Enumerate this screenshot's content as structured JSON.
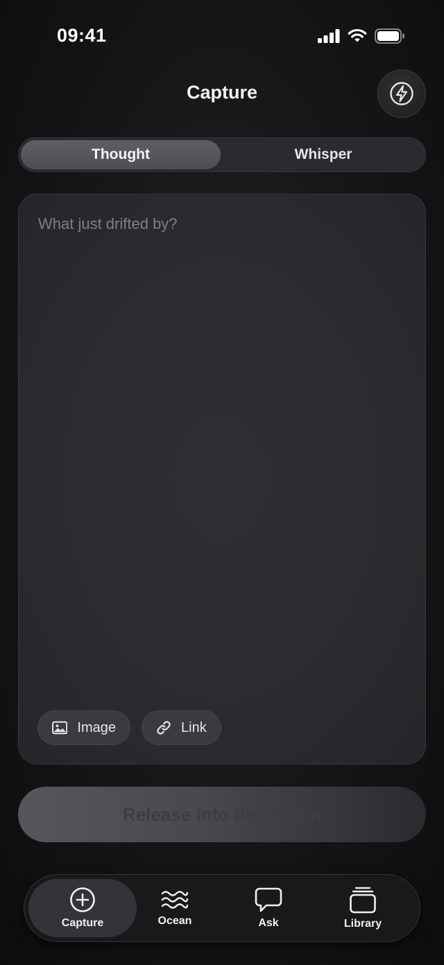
{
  "status_bar": {
    "time": "09:41"
  },
  "header": {
    "title": "Capture"
  },
  "mode_toggle": {
    "options": [
      "Thought",
      "Whisper"
    ],
    "selected": "Thought"
  },
  "composer": {
    "placeholder": "What just drifted by?",
    "attachments": [
      {
        "label": "Image",
        "icon": "image-icon"
      },
      {
        "label": "Link",
        "icon": "link-icon"
      }
    ]
  },
  "release_button": {
    "label": "Release into the Ocean"
  },
  "tab_bar": {
    "items": [
      {
        "label": "Capture",
        "icon": "plus-circle-icon",
        "active": true
      },
      {
        "label": "Ocean",
        "icon": "waves-icon",
        "active": false
      },
      {
        "label": "Ask",
        "icon": "chat-bubble-icon",
        "active": false
      },
      {
        "label": "Library",
        "icon": "stack-icon",
        "active": false
      }
    ]
  },
  "colors": {
    "background": "#151617",
    "surface": "#2a2b2e",
    "segment_active": "#55575c",
    "placeholder": "#7f8084",
    "release_text": "#3d3e42"
  }
}
